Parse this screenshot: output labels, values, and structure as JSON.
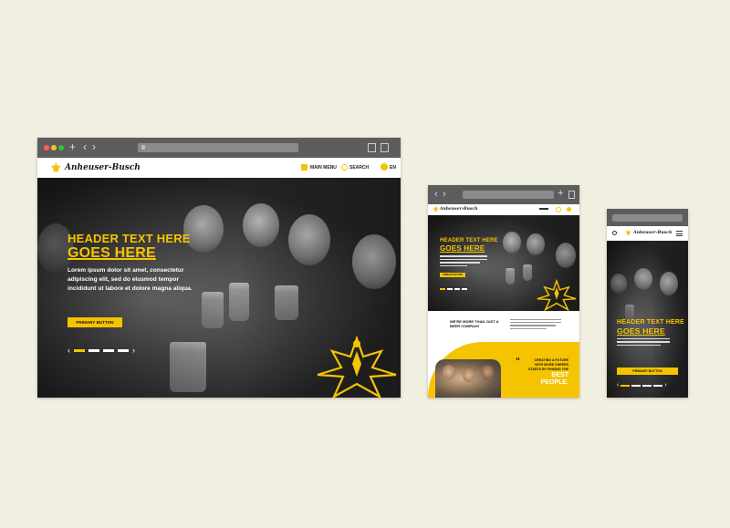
{
  "brand": {
    "logo_text": "Anheuser-Busch",
    "accent": "#f5c400",
    "background": "#f1efe0"
  },
  "desktop": {
    "nav": {
      "menu_label": "MAIN MENU",
      "search_label": "SEARCH",
      "lang_label": "EN"
    },
    "hero": {
      "header_line1": "HEADER TEXT HERE",
      "header_line2": "GOES HERE",
      "body": "Lorem ipsum dolor sit amet, consectetur adipiscing elit, sed do eiusmod tempor incididunt ut labore et dolore magna aliqua.",
      "button": "PRIMARY BUTTON"
    }
  },
  "tablet": {
    "hero": {
      "header_line1": "HEADER TEXT HERE",
      "header_line2": "GOES HERE",
      "button": "PRIMARY BUTTON"
    },
    "about_title": "WE'RE MORE THAN JUST A BEER COMPANY",
    "quote_line1": "CREATING A FUTURE",
    "quote_line2": "WITH MORE CHEERS",
    "quote_line3": "STARTS BY FINDING THE",
    "quote_line4": "BEST PEOPLE."
  },
  "mobile": {
    "hero": {
      "header_line1": "HEADER TEXT HERE",
      "header_line2": "GOES HERE",
      "button": "PRIMARY BUTTON"
    }
  },
  "icons": [
    "browser-close-dot",
    "browser-minimize-dot",
    "browser-maximize-dot",
    "plus-icon",
    "back-arrow-icon",
    "forward-arrow-icon",
    "share-icon",
    "tabs-icon",
    "menu-grid-icon",
    "search-icon",
    "globe-icon",
    "hamburger-icon",
    "quote-icon",
    "eagle-emblem-icon"
  ]
}
